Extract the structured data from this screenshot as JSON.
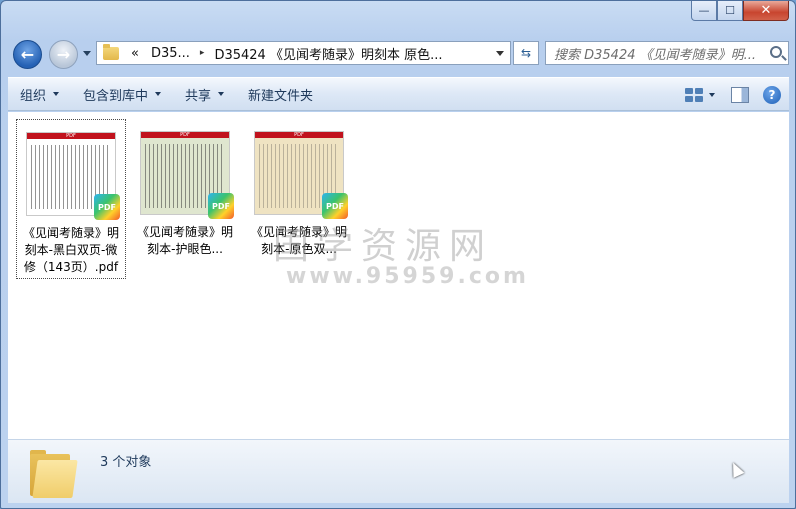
{
  "window": {
    "caption_buttons": {
      "minimize": "—",
      "maximize": "☐",
      "close": "✕"
    }
  },
  "nav": {
    "back_glyph": "←",
    "forward_glyph": "→",
    "address_parts": [
      "«",
      "D35...",
      "▸",
      "D35424 《见闻考随录》明刻本 原色..."
    ],
    "refresh_glyph": "⇆",
    "search_placeholder": "搜索 D35424 《见闻考随录》明..."
  },
  "commandbar": {
    "organize": "组织",
    "include_library": "包含到库中",
    "share": "共享",
    "new_folder": "新建文件夹",
    "help": "?"
  },
  "files": [
    {
      "name": "《见闻考随录》明刻本-黑白双页-微修（143页）.pdf",
      "style": "bw",
      "selected": true,
      "badge": "PDF",
      "header": "PDF"
    },
    {
      "name": "《见闻考随录》明刻本-护眼色...",
      "style": "green",
      "selected": false,
      "badge": "PDF",
      "header": "PDF"
    },
    {
      "name": "《见闻考随录》明刻本-原色双...",
      "style": "sepia",
      "selected": false,
      "badge": "PDF",
      "header": "PDF"
    }
  ],
  "watermark": {
    "line1": "国学资源网",
    "line2": "www.95959.com"
  },
  "details": {
    "status": "3 个对象"
  }
}
